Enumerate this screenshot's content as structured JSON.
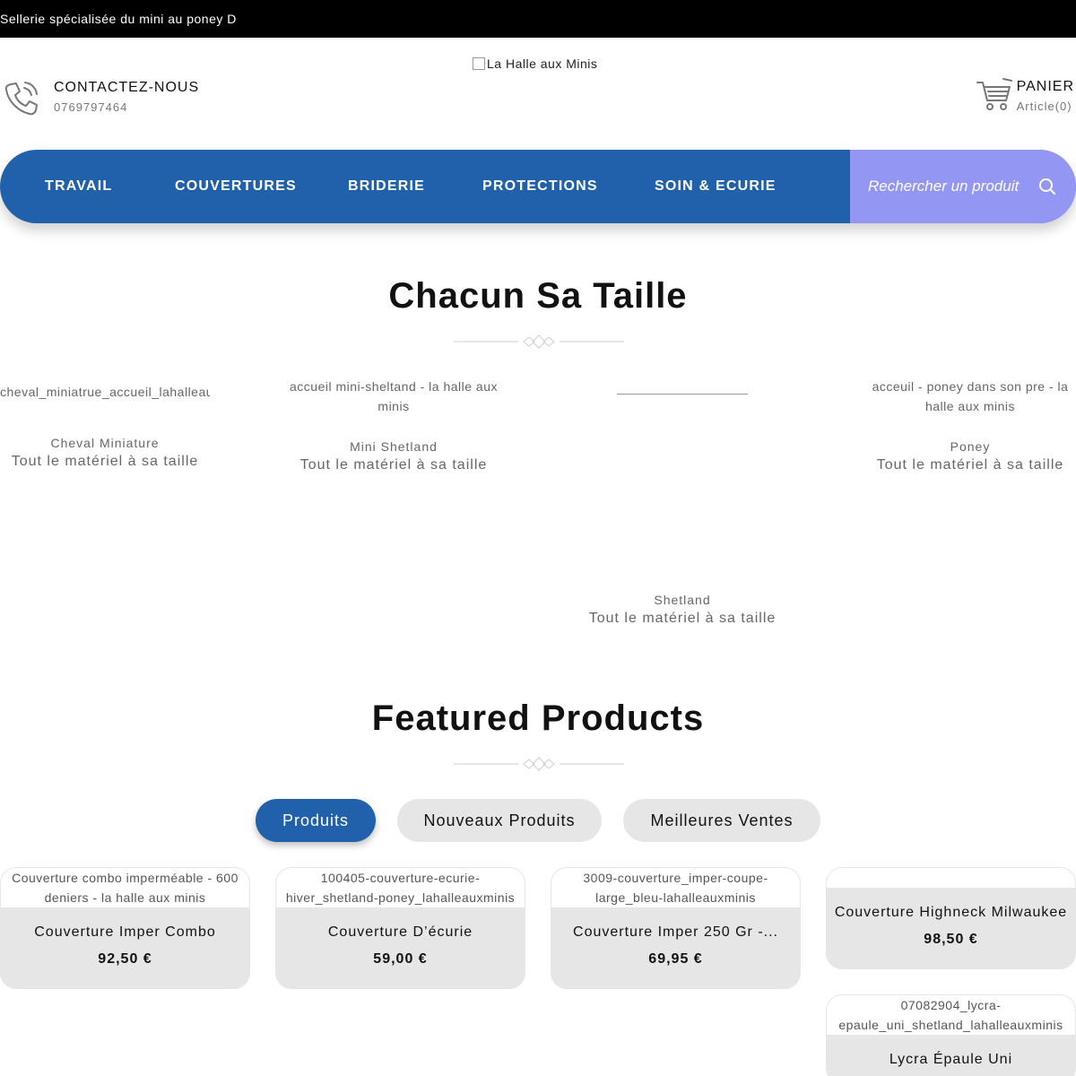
{
  "topbar": {
    "text": "Sellerie spécialisée du mini au poney D"
  },
  "header": {
    "contact_title": "CONTACTEZ-NOUS",
    "contact_phone": "0769797464",
    "logo_alt": "La Halle aux Minis",
    "cart_title": "PANIER",
    "cart_count": "Article(0)"
  },
  "nav": {
    "items": [
      "TRAVAIL",
      "COUVERTURES",
      "BRIDERIE",
      "PROTECTIONS",
      "SOIN & ECURIE"
    ],
    "search_placeholder": "Rechercher un produit"
  },
  "categories_section": {
    "title": "Chacun Sa Taille",
    "items": [
      {
        "alt": "cheval_miniatrue_accueil_lahalleauxminis",
        "name": "Cheval Miniature",
        "tagline": "Tout le matériel à sa taille"
      },
      {
        "alt": "accueil mini-sheltand - la halle aux minis",
        "name": "Mini Shetland",
        "tagline": "Tout le matériel à sa taille"
      },
      {
        "alt": "",
        "name": "Shetland",
        "tagline": "Tout le matériel à sa taille"
      },
      {
        "alt": "acceuil - poney dans son pre - la halle aux minis",
        "name": "Poney",
        "tagline": "Tout le matériel à sa taille"
      }
    ]
  },
  "featured_section": {
    "title": "Featured Products",
    "tabs": [
      "Produits",
      "Nouveaux Produits",
      "Meilleures Ventes"
    ],
    "products": [
      {
        "alt": "Couverture combo imperméable - 600 deniers - la halle aux minis",
        "name": "Couverture Imper Combo",
        "price": "92,50 €"
      },
      {
        "alt": "100405-couverture-ecurie-hiver_shetland-poney_lahalleauxminis",
        "name": "Couverture D’écurie",
        "price": "59,00 €"
      },
      {
        "alt": "3009-couverture_imper-coupe-large_bleu-lahalleauxminis",
        "name": "Couverture Imper 250 Gr -...",
        "price": "69,95 €"
      },
      {
        "alt": "",
        "name": "Couverture Highneck Milwaukee",
        "price": "98,50 €"
      },
      {
        "alt": "07082904_lycra-epaule_uni_shetland_lahalleauxminis",
        "name": "Lycra Épaule Uni",
        "price": ""
      }
    ]
  },
  "colors": {
    "primary": "#2160ab",
    "search_bg": "#9396f2",
    "topbar_bg": "#000000",
    "card_bg": "#e6e6e6"
  }
}
